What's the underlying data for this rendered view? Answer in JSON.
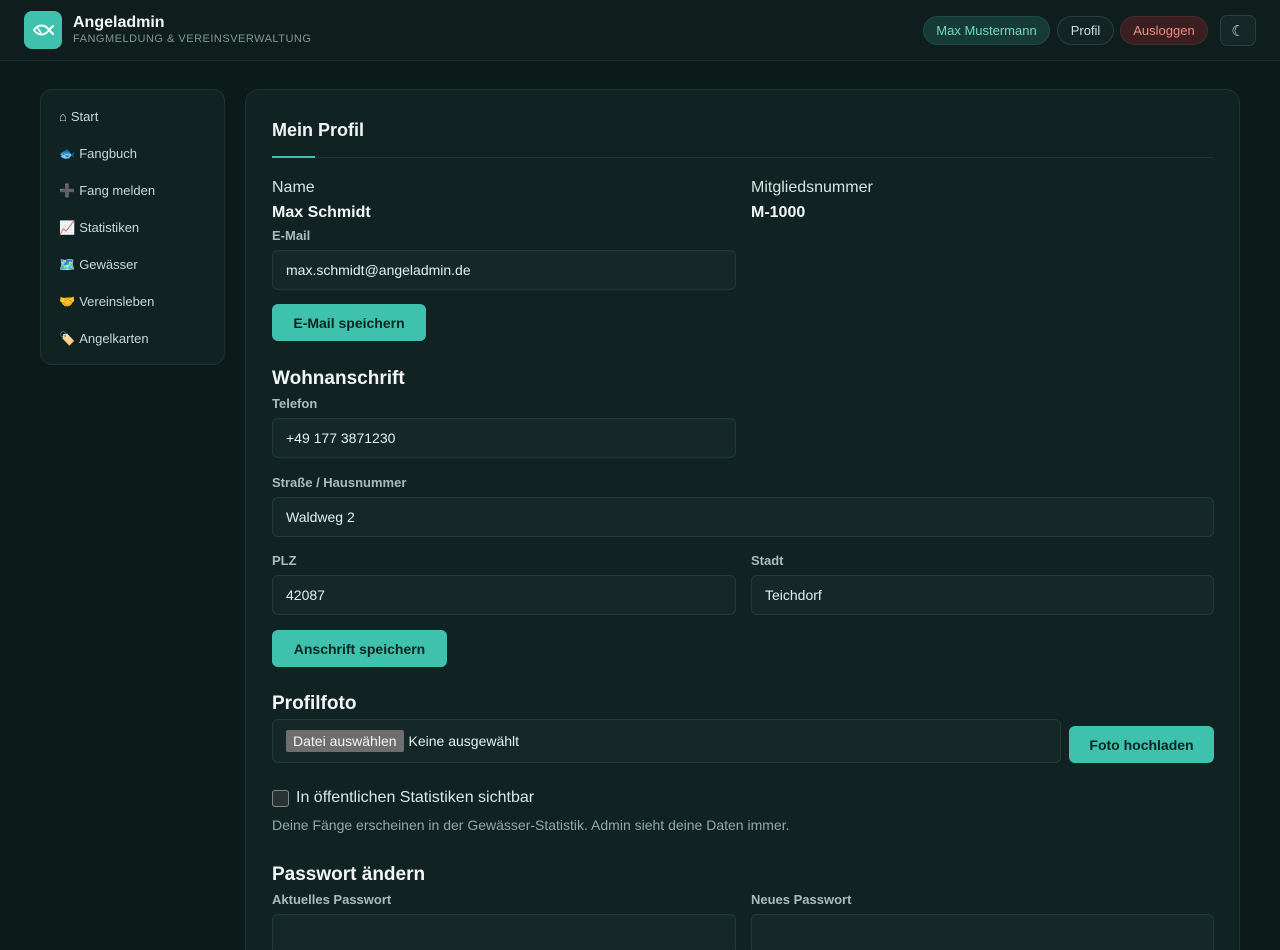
{
  "header": {
    "brand_title": "Angeladmin",
    "brand_subtitle": "FANGMELDUNG & VEREINSVERWALTUNG",
    "logo_icon": "fish-icon",
    "user_pill": "Max Mustermann",
    "profile_button": "Profil",
    "logout_button": "Ausloggen",
    "theme_toggle_icon": "moon-icon",
    "theme_toggle_glyph": "☾"
  },
  "sidebar": {
    "items": [
      {
        "icon": "⌂",
        "label": "Start"
      },
      {
        "icon": "🐟",
        "label": "Fangbuch"
      },
      {
        "icon": "➕",
        "label": "Fang melden"
      },
      {
        "icon": "📈",
        "label": "Statistiken"
      },
      {
        "icon": "🗺️",
        "label": "Gewässer"
      },
      {
        "icon": "🤝",
        "label": "Vereinsleben"
      },
      {
        "icon": "🏷️",
        "label": "Angelkarten"
      }
    ]
  },
  "profile": {
    "title": "Mein Profil",
    "name_label": "Name",
    "name_value": "Max Schmidt",
    "member_label": "Mitgliedsnummer",
    "member_value": "M-1000",
    "email_label": "E-Mail",
    "email_value": "max.schmidt@angeladmin.de",
    "email_save": "E-Mail speichern"
  },
  "address": {
    "title": "Wohnanschrift",
    "phone_label": "Telefon",
    "phone_value": "+49 177 3871230",
    "street_label": "Straße / Hausnummer",
    "street_value": "Waldweg 2",
    "zip_label": "PLZ",
    "zip_value": "42087",
    "city_label": "Stadt",
    "city_value": "Teichdorf",
    "save": "Anschrift speichern"
  },
  "photo": {
    "title": "Profilfoto",
    "choose_button": "Datei auswählen",
    "no_file": "Keine ausgewählt",
    "upload": "Foto hochladen"
  },
  "visibility": {
    "checked": false,
    "label": "In öffentlichen Statistiken sichtbar",
    "hint": "Deine Fänge erscheinen in der Gewässer-Statistik. Admin sieht deine Daten immer."
  },
  "password": {
    "title": "Passwort ändern",
    "current_label": "Aktuelles Passwort",
    "new_label": "Neues Passwort"
  },
  "colors": {
    "accent": "#3ec1ad",
    "background": "#0c1a1a",
    "card": "#112222",
    "logout": "#f08a80"
  }
}
